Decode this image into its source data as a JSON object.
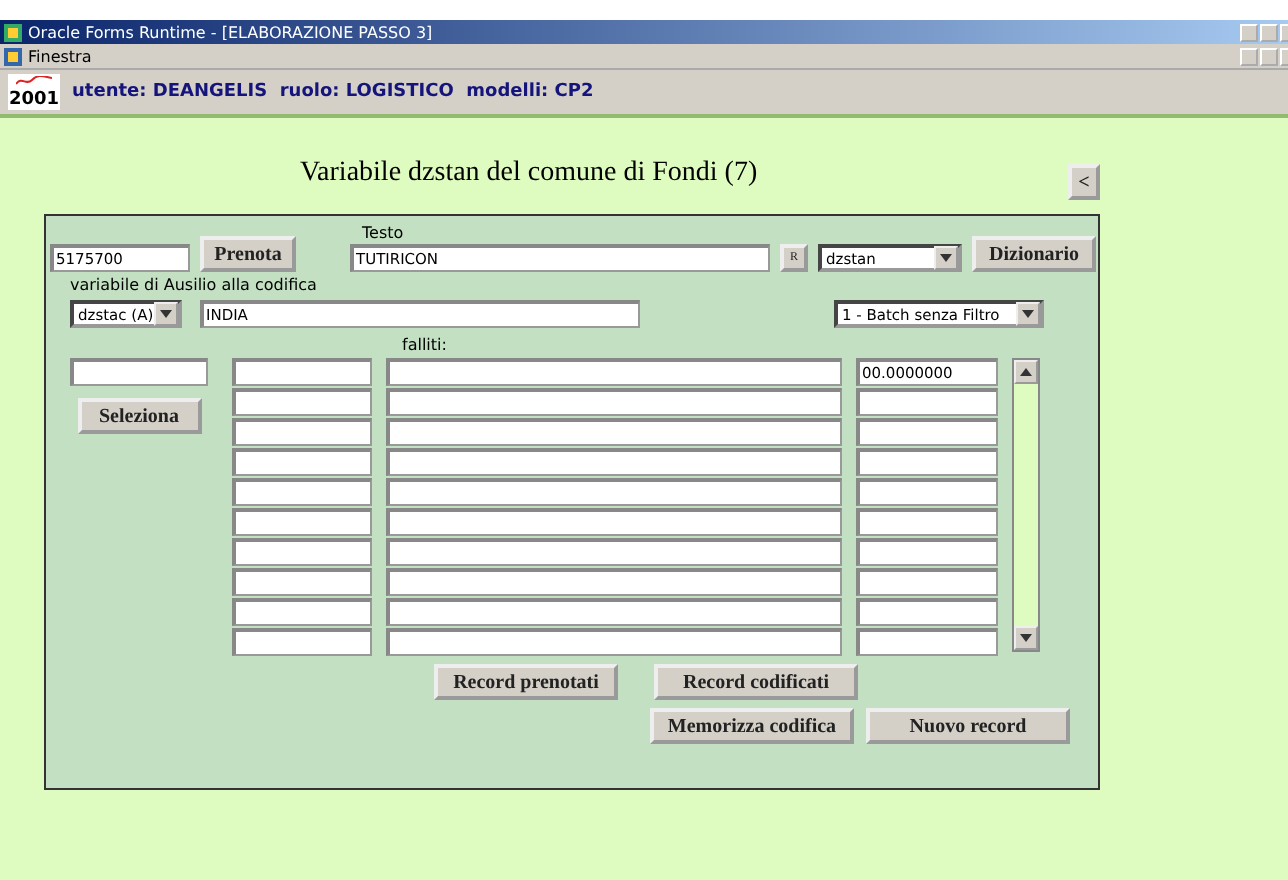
{
  "window": {
    "title": "Oracle Forms Runtime - [ELABORAZIONE PASSO 3]"
  },
  "menu_bar": {
    "items": [
      "Finestra"
    ]
  },
  "header": {
    "logo_year": "2001",
    "info": "utente: DEANGELIS  ruolo: LOGISTICO  modelli: CP2"
  },
  "form": {
    "heading": "Variabile dzstan del comune di Fondi (7)",
    "back_button": "<",
    "code_field": "5175700",
    "reserve_button": "Prenota",
    "text_label": "Testo",
    "text_field": "TUTIRICON",
    "r_button": "R",
    "variable_select": "dzstan",
    "dictionary_button": "Dizionario",
    "aux_label": "variabile di Ausilio alla codifica",
    "aux_select": "dzstac (A)",
    "aux_field": "INDIA",
    "mode_select": "1 - Batch senza Filtro",
    "failed_label": "falliti:",
    "select_button": "Seleziona",
    "rows": [
      {
        "kind": "filled",
        "column_4": "00.0000000"
      },
      {
        "kind": "empty"
      },
      {
        "kind": "empty"
      },
      {
        "kind": "empty"
      },
      {
        "kind": "empty"
      },
      {
        "kind": "empty"
      },
      {
        "kind": "empty"
      },
      {
        "kind": "empty"
      },
      {
        "kind": "empty"
      },
      {
        "kind": "empty"
      }
    ],
    "bottom_buttons": [
      [
        "Record prenotati",
        "Record codificati"
      ],
      [
        "Memorizza codifica",
        "Nuovo record"
      ]
    ]
  }
}
